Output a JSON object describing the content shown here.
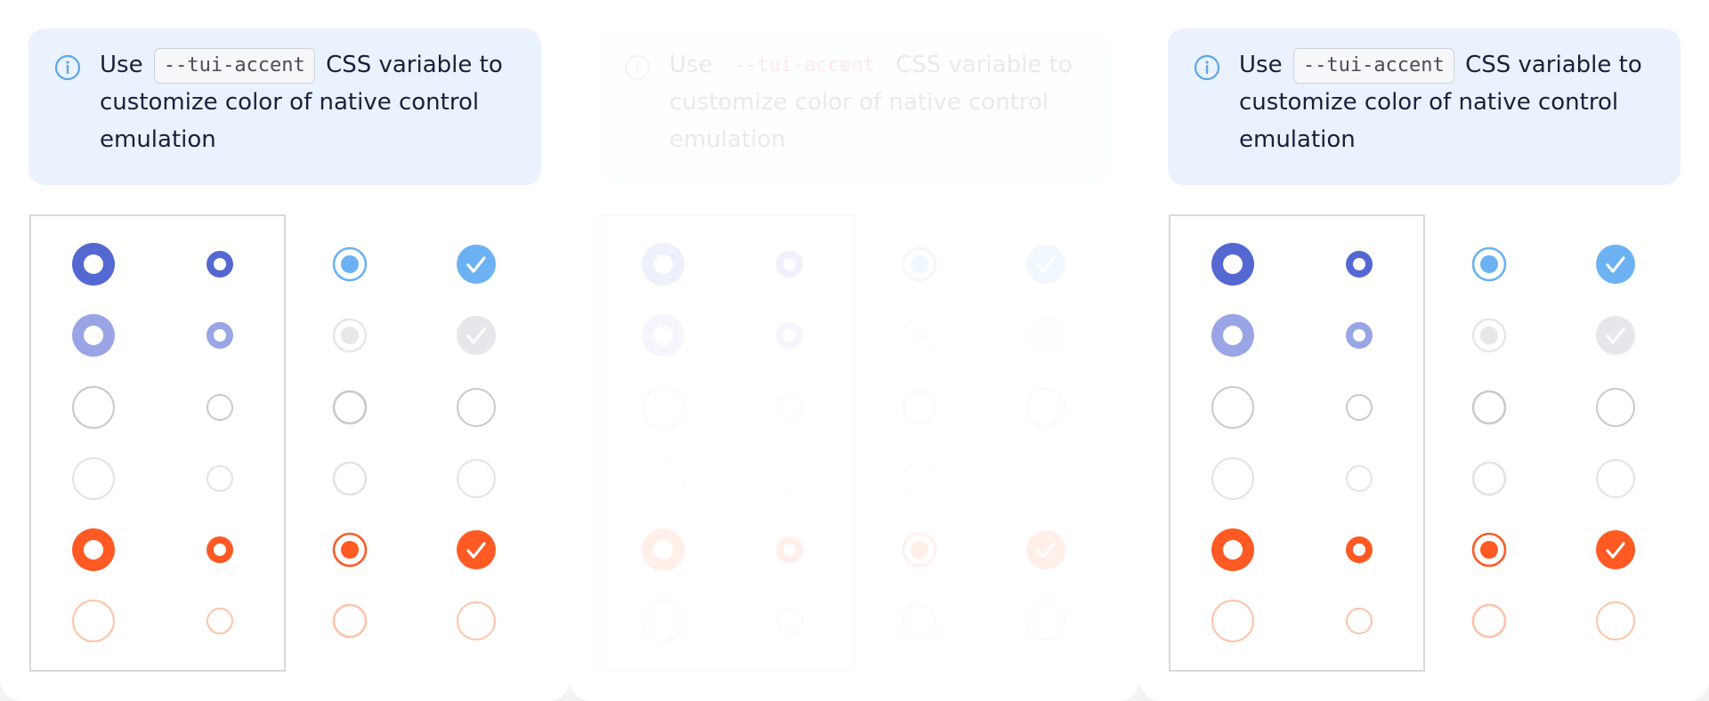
{
  "notice": {
    "before": "Use",
    "code": "--tui-accent",
    "after": "CSS variable to customize color of native control emulation"
  },
  "colors": {
    "accent": "#5567d1",
    "accent_light": "#9aa5e6",
    "checkbox_blue": "#6cb2f2",
    "orange": "#ff5a23",
    "orange_light": "#ffc2a8",
    "border_gray": "#c7c9cd",
    "border_light": "#e2e3e6",
    "disabled_fill": "#e6e7ea",
    "info_blue": "#5fa6e8"
  },
  "icons": {
    "info": "info-circle-icon",
    "check": "check-icon"
  },
  "rows": [
    {
      "name": "checked"
    },
    {
      "name": "checked-disabled"
    },
    {
      "name": "unchecked"
    },
    {
      "name": "unchecked-disabled"
    },
    {
      "name": "invalid-checked"
    },
    {
      "name": "invalid-unchecked-disabled"
    }
  ]
}
